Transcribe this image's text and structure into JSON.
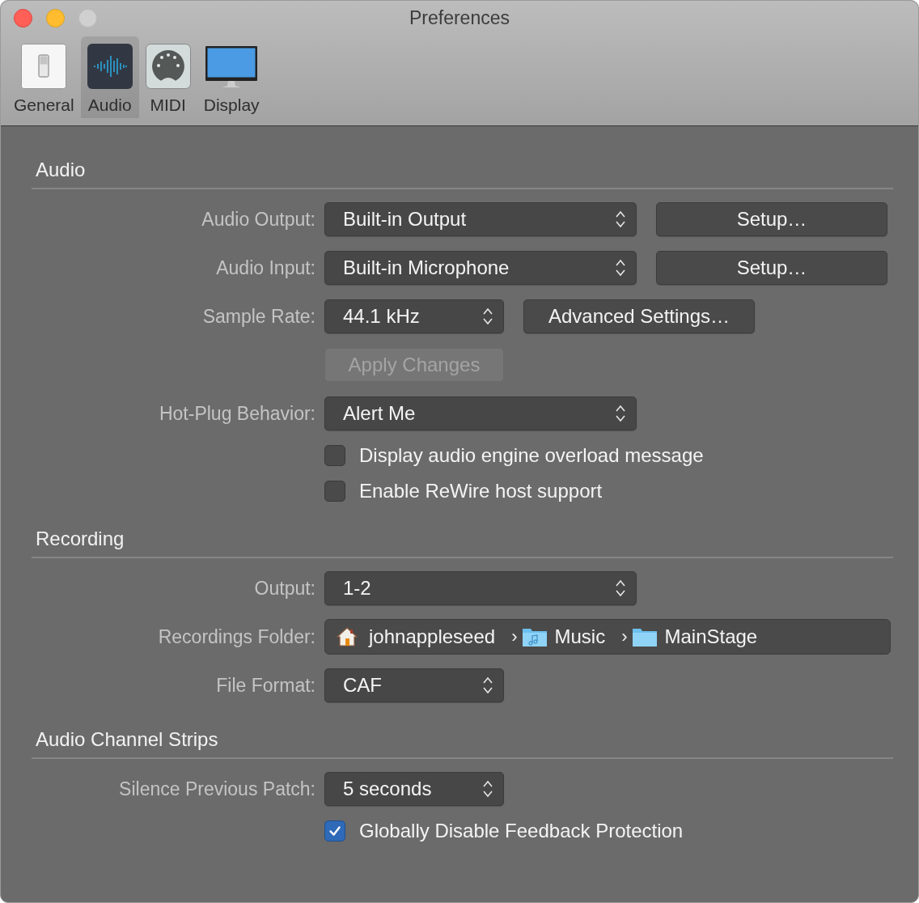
{
  "window": {
    "title": "Preferences"
  },
  "toolbar": [
    {
      "label": "General",
      "kind": "switch",
      "selected": false
    },
    {
      "label": "Audio",
      "kind": "waveform",
      "selected": true
    },
    {
      "label": "MIDI",
      "kind": "midi",
      "selected": false
    },
    {
      "label": "Display",
      "kind": "monitor",
      "selected": false
    }
  ],
  "sections": [
    {
      "title": "Audio",
      "rows": [
        {
          "kind": "popup-wide",
          "label": "Audio Output:",
          "value": "Built-in Output",
          "side_button": "Setup…"
        },
        {
          "kind": "popup-wide",
          "label": "Audio Input:",
          "value": "Built-in Microphone",
          "side_button": "Setup…"
        },
        {
          "kind": "popup-narrow",
          "label": "Sample Rate:",
          "value": "44.1 kHz",
          "side_button": "Advanced Settings…"
        },
        {
          "kind": "button",
          "text": "Apply Changes",
          "disabled": true
        },
        {
          "kind": "popup-wide",
          "label": "Hot-Plug Behavior:",
          "value": "Alert Me"
        },
        {
          "kind": "checkbox",
          "text": "Display audio engine overload message",
          "checked": false
        },
        {
          "kind": "checkbox",
          "text": "Enable ReWire host support",
          "checked": false
        }
      ]
    },
    {
      "title": "Recording",
      "rows": [
        {
          "kind": "popup-wide",
          "label": "Output:",
          "value": "1-2"
        },
        {
          "kind": "path",
          "label": "Recordings Folder:",
          "segments": [
            {
              "kind": "home",
              "name": "johnappleseed"
            },
            {
              "separator": "›",
              "kind": "music-folder",
              "name": "Music"
            },
            {
              "separator": "›",
              "kind": "folder",
              "name": "MainStage"
            }
          ]
        },
        {
          "kind": "popup-narrow",
          "label": "File Format:",
          "value": "CAF"
        }
      ]
    },
    {
      "title": "Audio Channel Strips",
      "rows": [
        {
          "kind": "popup-narrow",
          "label": "Silence Previous Patch:",
          "value": "5 seconds"
        },
        {
          "kind": "checkbox",
          "text": "Globally Disable Feedback Protection",
          "checked": true
        }
      ]
    }
  ]
}
